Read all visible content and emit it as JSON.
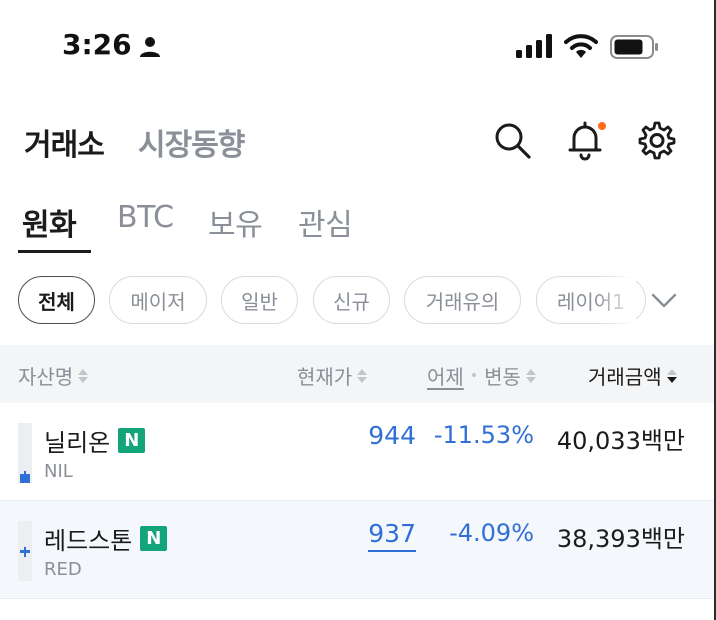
{
  "status_bar": {
    "time": "3:26",
    "icons": [
      "person-icon",
      "signal-icon",
      "wifi-icon",
      "battery-icon"
    ]
  },
  "header": {
    "title": "거래소",
    "subtitle": "시장동향",
    "icons": [
      "search-icon",
      "bell-icon",
      "gear-icon"
    ],
    "notification_dot_color": "#ff6b1a"
  },
  "tabs": [
    {
      "label": "원화",
      "active": true
    },
    {
      "label": "BTC",
      "active": false
    },
    {
      "label": "보유",
      "active": false
    },
    {
      "label": "관심",
      "active": false
    }
  ],
  "filters": [
    {
      "label": "전체",
      "active": true
    },
    {
      "label": "메이저",
      "active": false
    },
    {
      "label": "일반",
      "active": false
    },
    {
      "label": "신규",
      "active": false
    },
    {
      "label": "거래유의",
      "active": false
    },
    {
      "label": "레이어1",
      "active": false
    }
  ],
  "columns": {
    "asset": "자산명",
    "price": "현재가",
    "change_prefix": "어제",
    "change": "변동",
    "volume": "거래금액"
  },
  "rows": [
    {
      "name": "닐리온",
      "badge": "N",
      "ticker": "NIL",
      "price": "944",
      "change": "-11.53%",
      "volume": "40,033백만"
    },
    {
      "name": "레드스톤",
      "badge": "N",
      "ticker": "RED",
      "price": "937",
      "change": "-4.09%",
      "volume": "38,393백만"
    }
  ],
  "colors": {
    "down": "#2f6fd6",
    "new_badge": "#14a47a"
  }
}
